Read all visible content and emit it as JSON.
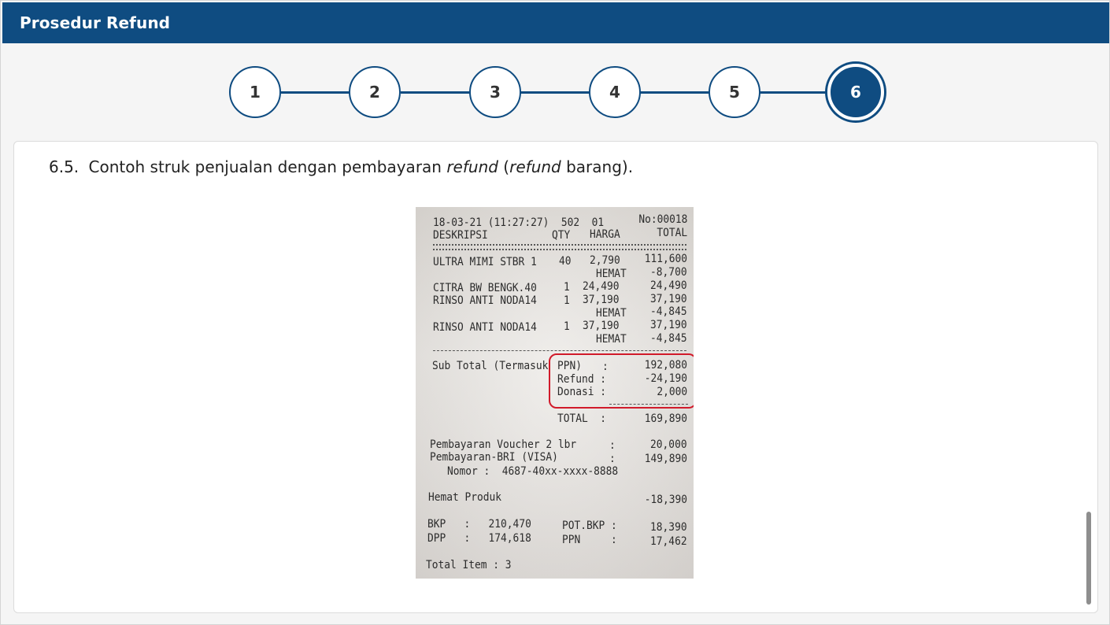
{
  "header": {
    "title": "Prosedur Refund"
  },
  "stepper": {
    "steps": [
      "1",
      "2",
      "3",
      "4",
      "5",
      "6"
    ],
    "active": "6"
  },
  "content": {
    "caption": {
      "number": "6.5.",
      "text_before": "Contoh struk penjualan dengan pembayaran ",
      "italic1": "refund",
      "text_mid": " (",
      "italic2": "refund",
      "text_after": " barang)."
    },
    "receipt": {
      "top_left": "18-03-21 (11:27:27)  502  01",
      "receipt_no": "No:00018",
      "col_desc": "DESKRIPSI",
      "col_qty": "QTY",
      "col_price": "HARGA",
      "col_total": "TOTAL",
      "items": [
        {
          "desc": "ULTRA MIMI STBR 1",
          "qty": "40",
          "price": "2,790",
          "total": "111,600"
        },
        {
          "desc": "",
          "qty": "",
          "price": "HEMAT",
          "total": "-8,700"
        },
        {
          "desc": "CITRA BW BENGK.40",
          "qty": "1",
          "price": "24,490",
          "total": "24,490"
        },
        {
          "desc": "RINSO ANTI NODA14",
          "qty": "1",
          "price": "37,190",
          "total": "37,190"
        },
        {
          "desc": "",
          "qty": "",
          "price": "HEMAT",
          "total": "-4,845"
        },
        {
          "desc": "RINSO ANTI NODA14",
          "qty": "1",
          "price": "37,190",
          "total": "37,190"
        },
        {
          "desc": "",
          "qty": "",
          "price": "HEMAT",
          "total": "-4,845"
        }
      ],
      "subtotal_label": "Sub Total (Termasuk",
      "ppn_label": "PPN)",
      "ppn_colon": ":",
      "subtotal_value": "192,080",
      "refund_label": "Refund :",
      "refund_value": "-24,190",
      "donasi_label": "Donasi :",
      "donasi_value": "2,000",
      "total_label": "TOTAL  :",
      "total_value": "169,890",
      "voucher_label": "Pembayaran Voucher 2 lbr",
      "voucher_colon": ":",
      "voucher_value": "20,000",
      "bri_label": "Pembayaran-BRI (VISA)",
      "bri_colon": ":",
      "bri_value": "149,890",
      "card_number": "Nomor :  4687-40xx-xxxx-8888",
      "hemat_label": "Hemat Produk",
      "hemat_value": "-18,390",
      "bkp_line": "BKP   :   210,470",
      "potbkp_label": "POT.BKP :",
      "potbkp_value": "18,390",
      "dpp_line": "DPP   :   174,618",
      "ppn2_label": "PPN     :",
      "ppn2_value": "17,462",
      "total_item": "Total Item : 3"
    }
  },
  "colors": {
    "primary": "#0f4c81",
    "highlight": "#d11a2a"
  }
}
